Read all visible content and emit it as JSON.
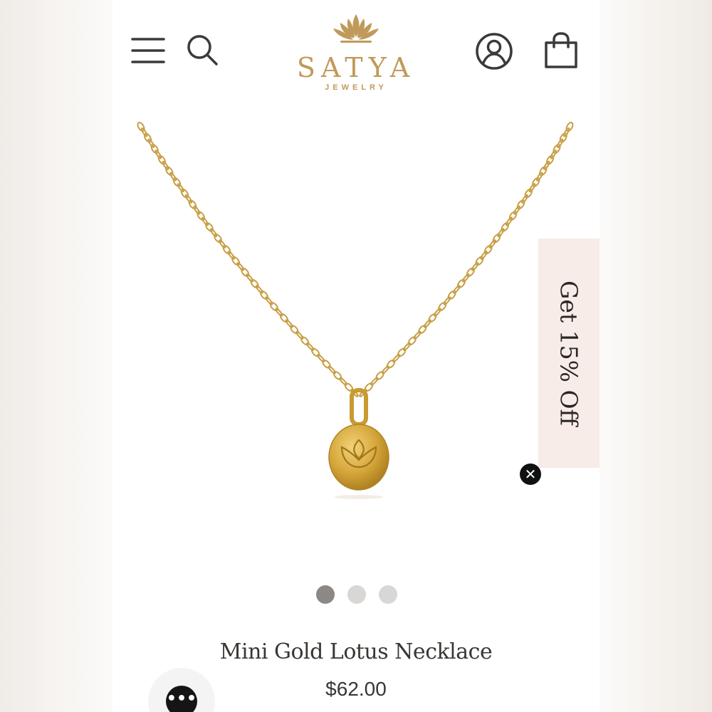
{
  "header": {
    "brand_name": "SATYA",
    "brand_sub": "JEWELRY",
    "icons": {
      "menu": "hamburger-icon",
      "search": "search-icon",
      "account": "user-icon",
      "cart": "shopping-bag-icon",
      "logo": "lotus-icon"
    }
  },
  "promo": {
    "label": "Get 15% Off",
    "close_glyph": "✕",
    "close_icon": "close-icon"
  },
  "gallery": {
    "slide_count": 3,
    "active_index": 0
  },
  "product": {
    "title": "Mini Gold Lotus Necklace",
    "price": "$62.00"
  },
  "chat": {
    "glyph": "•••",
    "icon": "chat-ellipsis-icon"
  },
  "colors": {
    "brand_gold": "#c09a5a",
    "icon_gray": "#3c3a39",
    "promo_bg": "#f7ece7",
    "dot_active": "#8c8886",
    "dot_inactive": "#d9d7d6"
  }
}
